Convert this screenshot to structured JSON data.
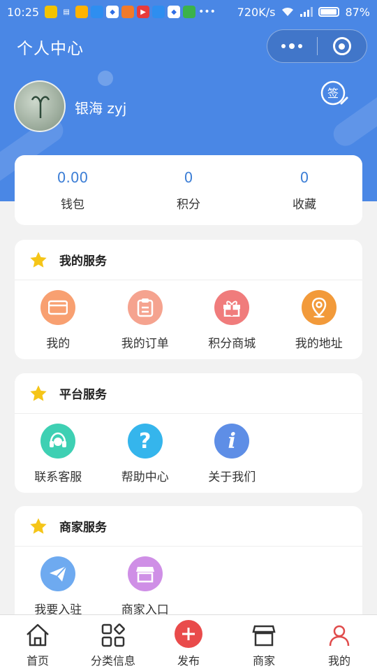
{
  "status_bar": {
    "time": "10:25",
    "network_speed": "720K/s",
    "battery": "87%",
    "battery_level": 0.87
  },
  "nav": {
    "title": "个人中心"
  },
  "profile": {
    "username": "银海 zyj",
    "sign_label": "签"
  },
  "stats": [
    {
      "value": "0.00",
      "label": "钱包"
    },
    {
      "value": "0",
      "label": "积分"
    },
    {
      "value": "0",
      "label": "收藏"
    }
  ],
  "sections": [
    {
      "title": "我的服务",
      "items": [
        {
          "label": "我的",
          "icon": "card-icon",
          "color": "#f8a071"
        },
        {
          "label": "我的订单",
          "icon": "clipboard-icon",
          "color": "#f5a38f"
        },
        {
          "label": "积分商城",
          "icon": "gift-icon",
          "color": "#f07c7c"
        },
        {
          "label": "我的地址",
          "icon": "location-icon",
          "color": "#f29a3a"
        }
      ]
    },
    {
      "title": "平台服务",
      "items": [
        {
          "label": "联系客服",
          "icon": "headset-icon",
          "color": "#3ed0b3"
        },
        {
          "label": "帮助中心",
          "icon": "question-icon",
          "color": "#35b5ec"
        },
        {
          "label": "关于我们",
          "icon": "info-icon",
          "color": "#5e8ee6"
        }
      ]
    },
    {
      "title": "商家服务",
      "items": [
        {
          "label": "我要入驻",
          "icon": "paper-plane-icon",
          "color": "#6eaaf0"
        },
        {
          "label": "商家入口",
          "icon": "store-icon",
          "color": "#cf8fe6"
        }
      ]
    }
  ],
  "tabbar": [
    {
      "label": "首页",
      "icon": "home-icon"
    },
    {
      "label": "分类信息",
      "icon": "grid-icon"
    },
    {
      "label": "发布",
      "icon": "plus-icon"
    },
    {
      "label": "商家",
      "icon": "store-icon"
    },
    {
      "label": "我的",
      "icon": "user-icon"
    }
  ],
  "colors": {
    "header_blue": "#4a87e5",
    "stat_value_blue": "#3e7fd6",
    "star_yellow": "#f5c518"
  }
}
